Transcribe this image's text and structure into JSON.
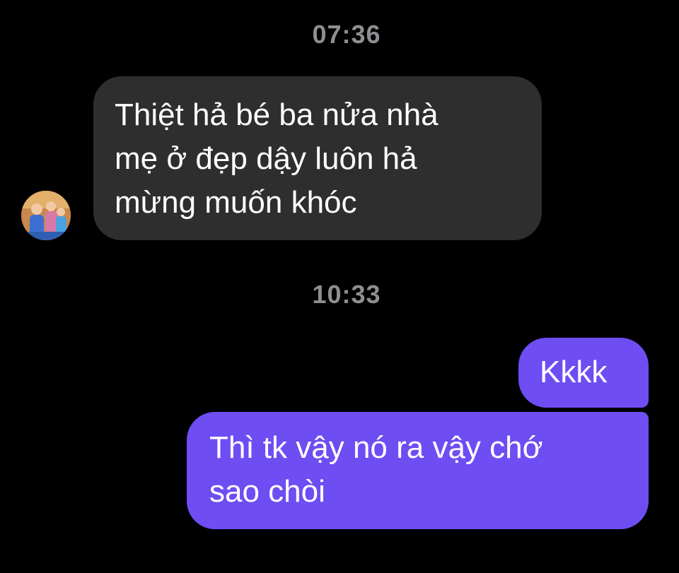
{
  "timestamps": [
    "07:36",
    "10:33"
  ],
  "messages": {
    "incoming": {
      "lines": [
        "Thiệt hả bé ba nửa nhà",
        "mẹ ở đẹp dậy luôn hả",
        "mừng muốn khóc"
      ]
    },
    "outgoing_1": {
      "text": "Kkkk"
    },
    "outgoing_2": {
      "lines": [
        "Thì tk vậy nó ra vậy chớ",
        "sao chòi"
      ]
    }
  },
  "colors": {
    "background": "#000000",
    "incoming_bubble": "#2e2e2e",
    "outgoing_bubble": "#6e4df3",
    "timestamp_text": "#8e8e93",
    "message_text": "#ffffff"
  }
}
